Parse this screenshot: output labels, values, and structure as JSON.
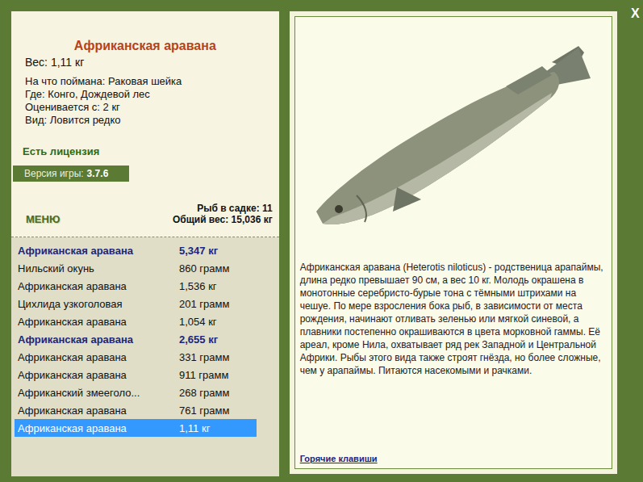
{
  "title": "Африканская аравана",
  "details": [
    "Вес: 1,11 кг",
    "На что поймана: Раковая шейка",
    "Где: Конго, Дождевой лес",
    "Оценивается с: 2 кг",
    "Вид: Ловится редко"
  ],
  "license": "Есть лицензия",
  "version": {
    "label": "Версия игры:",
    "value": "3.7.6"
  },
  "menu": "МЕНЮ",
  "keepnet": {
    "count": "Рыб в садке: 11",
    "weight": "Общий вес: 15,036 кг"
  },
  "catches": [
    {
      "name": "Африканская аравана",
      "weight": "5,347 кг",
      "highlighted": true,
      "selected": false
    },
    {
      "name": "Нильский окунь",
      "weight": "860 грамм",
      "highlighted": false,
      "selected": false
    },
    {
      "name": "Африканская аравана",
      "weight": "1,536 кг",
      "highlighted": false,
      "selected": false
    },
    {
      "name": "Цихлида узкоголовая",
      "weight": "201 грамм",
      "highlighted": false,
      "selected": false
    },
    {
      "name": "Африканская аравана",
      "weight": "1,054 кг",
      "highlighted": false,
      "selected": false
    },
    {
      "name": "Африканская аравана",
      "weight": "2,655 кг",
      "highlighted": true,
      "selected": false
    },
    {
      "name": "Африканская аравана",
      "weight": "331 грамм",
      "highlighted": false,
      "selected": false
    },
    {
      "name": "Африканская аравана",
      "weight": "911 грамм",
      "highlighted": false,
      "selected": false
    },
    {
      "name": "Африканский змееголо...",
      "weight": "268 грамм",
      "highlighted": false,
      "selected": false
    },
    {
      "name": "Африканская аравана",
      "weight": "761 грамм",
      "highlighted": false,
      "selected": false
    },
    {
      "name": "Африканская аравана",
      "weight": "1,11 кг",
      "highlighted": false,
      "selected": true
    }
  ],
  "description": "Африканская аравана (Heterotis niloticus) - родственица арапаймы, длина редко превышает 90 см, а вес 10 кг. Молодь окрашена в монотонные серебристо-бурые тона с тёмными штрихами на чешуе. По мере взросления бока рыб, в зависимости от места рождения, начинают отливать зеленью или мягкой синевой, а плавники постепенно окрашиваются в цвета морковной гаммы. Её ареал, кроме Нила, охватывает ряд рек Западной и Центральной Африки. Рыбы этого вида также строят гнёзда, но более сложные, чем у арапаймы. Питаются насекомыми и рачками.",
  "hotkeys": "Горячие клавиши",
  "close": "X"
}
